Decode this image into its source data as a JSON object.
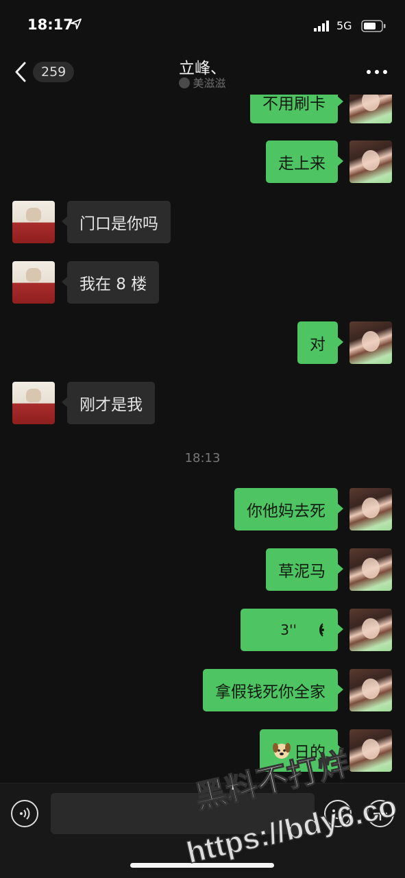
{
  "status_bar": {
    "time": "18:17",
    "network": "5G"
  },
  "nav": {
    "unread_count": "259",
    "title": "立峰、",
    "subtitle": "美滋滋"
  },
  "messages": [
    {
      "side": "me",
      "text": "不用刷卡"
    },
    {
      "side": "me",
      "text": "走上来"
    },
    {
      "side": "them",
      "text": "门口是你吗"
    },
    {
      "side": "them",
      "text": "我在 8 楼"
    },
    {
      "side": "me",
      "text": "对"
    },
    {
      "side": "them",
      "text": "刚才是我"
    },
    {
      "side": "me",
      "text": "你他妈去死"
    },
    {
      "side": "me",
      "text": "草泥马"
    },
    {
      "side": "me",
      "voice_duration": "3''"
    },
    {
      "side": "me",
      "text": "拿假钱死你全家"
    },
    {
      "side": "me",
      "text": "日的"
    }
  ],
  "timestamp": "18:13",
  "input": {
    "value": "",
    "placeholder": ""
  },
  "watermark": {
    "line1": "黑料不打烊",
    "line2": "https://bdy6.co"
  }
}
